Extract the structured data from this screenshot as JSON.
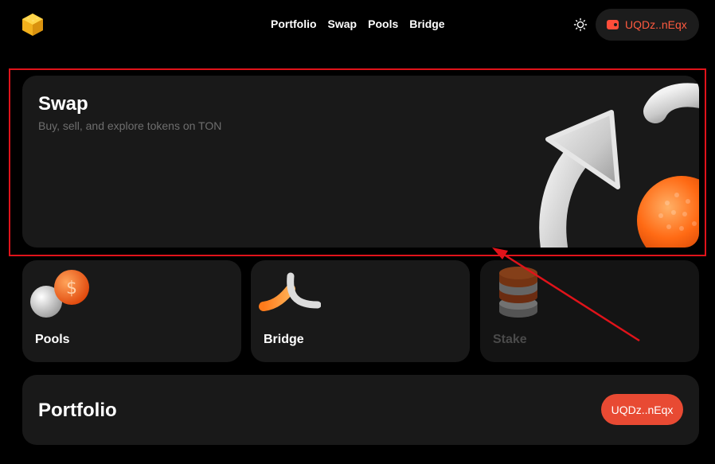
{
  "header": {
    "logo_icon": "cube-logo-icon",
    "nav": [
      {
        "label": "Portfolio"
      },
      {
        "label": "Swap"
      },
      {
        "label": "Pools"
      },
      {
        "label": "Bridge"
      }
    ],
    "theme_icon": "sun-icon",
    "wallet": {
      "icon": "wallet-icon",
      "label": "UQDz..nEqx"
    }
  },
  "swap_card": {
    "title": "Swap",
    "subtitle": "Buy, sell, and explore tokens on TON",
    "art": "arrow-and-orange-sphere-illustration"
  },
  "tiles": [
    {
      "label": "Pools",
      "art": "coins-illustration",
      "enabled": true
    },
    {
      "label": "Bridge",
      "art": "bridge-illustration",
      "enabled": true
    },
    {
      "label": "Stake",
      "art": "coin-stack-illustration",
      "enabled": false
    }
  ],
  "portfolio": {
    "title": "Portfolio",
    "wallet_label": "UQDz..nEqx"
  },
  "colors": {
    "background": "#000000",
    "card": "#191919",
    "accent": "#e84a33",
    "highlight": "#e0131a"
  }
}
